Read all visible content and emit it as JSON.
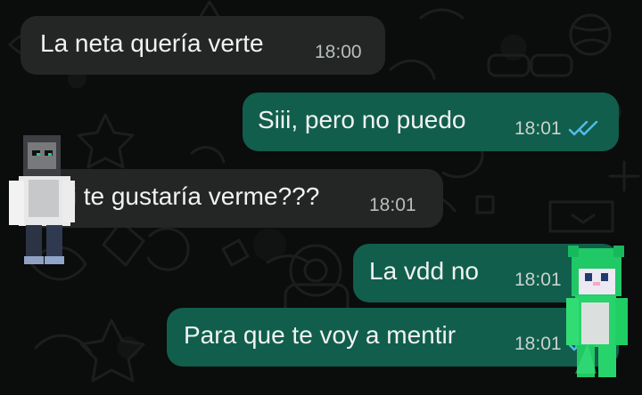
{
  "chat": {
    "messages": [
      {
        "direction": "incoming",
        "text": "La neta quería verte",
        "time": "18:00"
      },
      {
        "direction": "outgoing",
        "text": "Siii, pero no puedo",
        "time": "18:01",
        "status": "read-double-check-icon"
      },
      {
        "direction": "incoming",
        "text": "A ti te gustaría verme???",
        "time": "18:01"
      },
      {
        "direction": "outgoing",
        "text": "La vdd no",
        "time": "18:01"
      },
      {
        "direction": "outgoing",
        "text": "Para que te voy a mentir",
        "time": "18:01",
        "status": "read-double-check-icon"
      }
    ]
  },
  "colors": {
    "background": "#0b0c0c",
    "incoming_bubble": "#242626",
    "outgoing_bubble": "#115e4c",
    "text": "#f1f3f2",
    "read_check": "#53bdeb"
  },
  "stickers": [
    {
      "name": "gray-blocky-character-sticker"
    },
    {
      "name": "green-blocky-character-sticker"
    }
  ]
}
